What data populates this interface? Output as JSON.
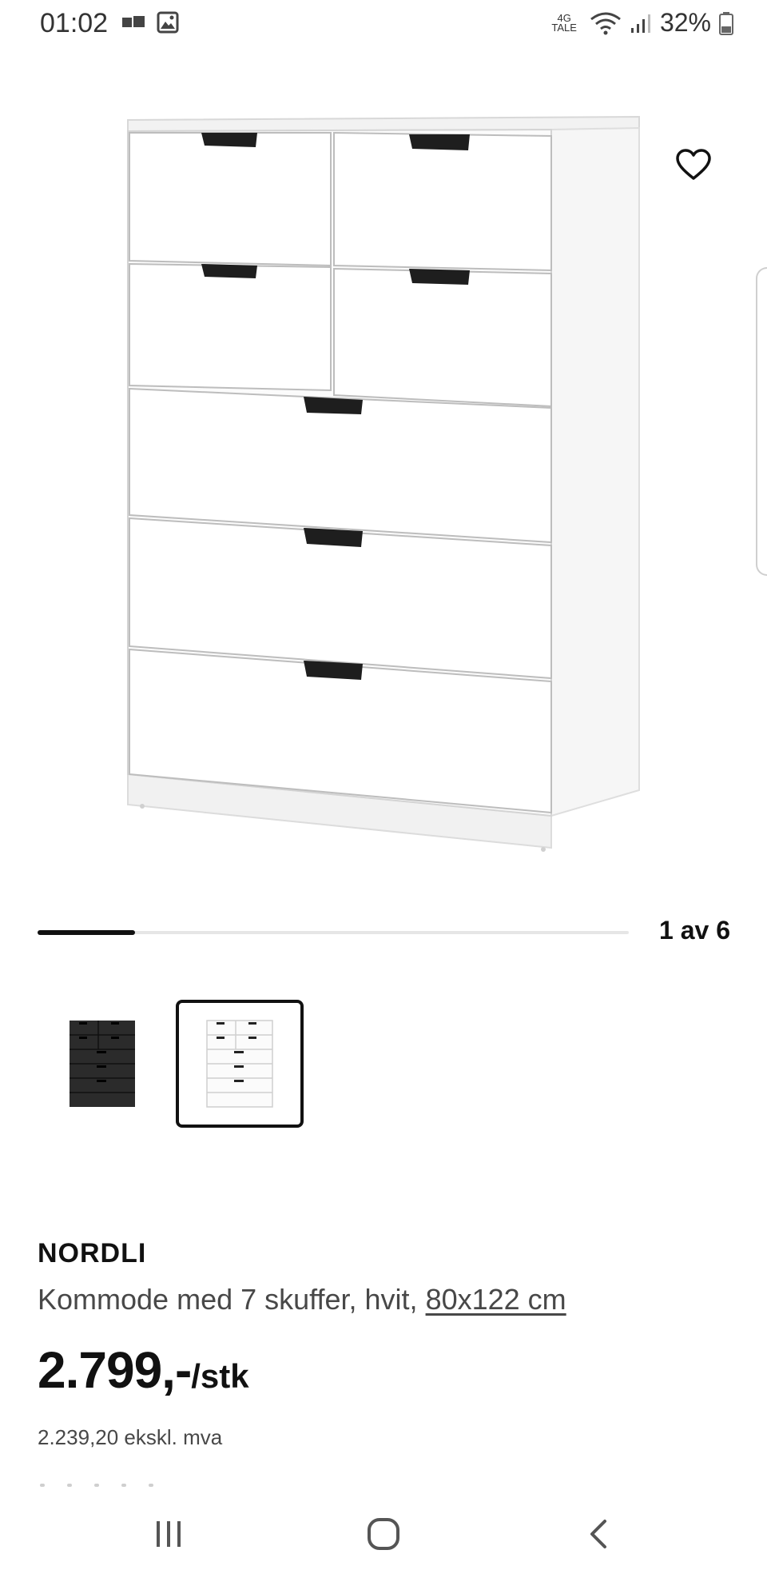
{
  "status_bar": {
    "time": "01:02",
    "network_top": "4G",
    "network_bottom": "TALE",
    "battery": "32%"
  },
  "gallery": {
    "pager_text": "1 av 6",
    "current": 1,
    "total": 6
  },
  "product": {
    "name": "NORDLI",
    "description": "Kommode med 7 skuffer, hvit, ",
    "dimensions": "80x122 cm",
    "price": "2.799,-",
    "price_unit": "/stk",
    "price_ex_vat": "2.239,20 ekskl. mva"
  },
  "icons": {
    "wishlist": "heart-outline-icon",
    "recent": "recent-apps-icon",
    "home": "home-icon",
    "back": "back-icon"
  },
  "colors": {
    "text": "#111111",
    "secondary_text": "#484848",
    "white_finish": "#ffffff",
    "anthracite_finish": "#2b2b2b"
  }
}
